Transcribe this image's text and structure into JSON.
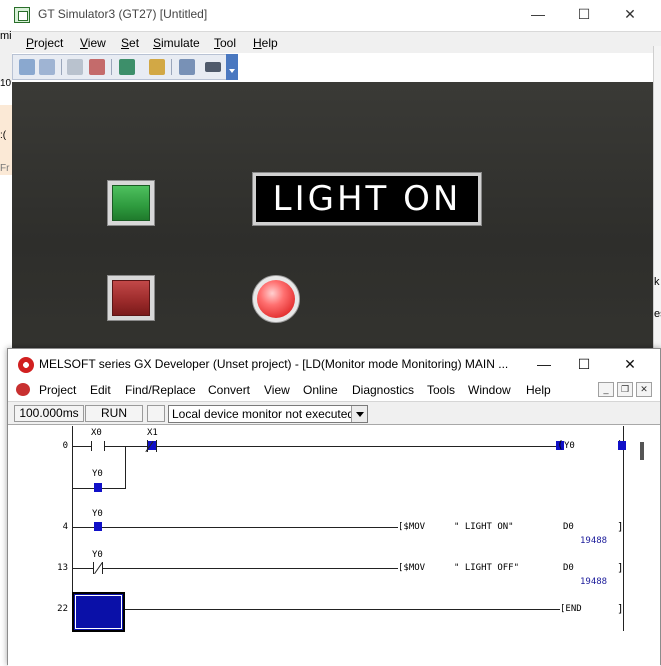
{
  "gt": {
    "title": "GT Simulator3 (GT27)  [Untitled]",
    "menu": [
      "Project",
      "View",
      "Set",
      "Simulate",
      "Tool",
      "Help"
    ],
    "menu_mnemonic": [
      "P",
      "V",
      "S",
      "S",
      "T",
      "H"
    ],
    "window_controls": {
      "minimize": "—",
      "maximize": "☐",
      "close": "✕"
    },
    "display_text": "LIGHT ON",
    "colors": {
      "screen": "#33332f",
      "green_button": "#2e9a3e",
      "red_button": "#9a2a2a",
      "lamp": "#e02a2a"
    },
    "left_stub_text": [
      "mi",
      "10",
      ":(",
      "Fr"
    ],
    "right_stub_text": [
      "k",
      "es"
    ]
  },
  "gx": {
    "title": "MELSOFT series GX Developer (Unset project) - [LD(Monitor mode Monitoring)   MAIN  ...",
    "menu": [
      "Project",
      "Edit",
      "Find/Replace",
      "Convert",
      "View",
      "Online",
      "Diagnostics",
      "Tools",
      "Window",
      "Help"
    ],
    "window_controls": {
      "minimize": "—",
      "maximize": "☐",
      "close": "✕"
    },
    "mdi_controls": {
      "minimize": "_",
      "restore": "❐",
      "close": "✕"
    },
    "status": {
      "scan_time": "100.000ms",
      "state": "RUN",
      "monitor": "Local device monitor not executed"
    },
    "ladder": {
      "rungs": [
        {
          "step": "0",
          "contacts": [
            "X0",
            "X1"
          ],
          "branch": "Y0",
          "coil": "Y0"
        },
        {
          "step": "4",
          "contact": "Y0",
          "instruction": "[$MOV",
          "operand": "\" LIGHT ON\"",
          "dest": "D0",
          "value": "19488"
        },
        {
          "step": "13",
          "contact": "Y0",
          "instruction": "[$MOV",
          "operand": "\" LIGHT OFF\"",
          "dest": "D0",
          "value": "19488"
        },
        {
          "step": "22",
          "instruction": "[END"
        }
      ],
      "bracket_close": "]",
      "coil_open": "(",
      "coil_close": ")"
    }
  }
}
